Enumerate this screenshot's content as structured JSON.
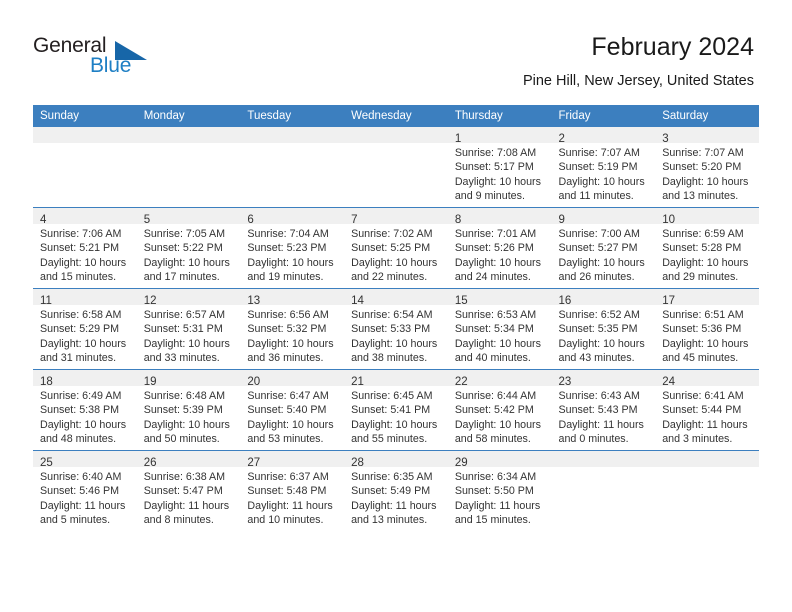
{
  "brand": {
    "name_part1": "General",
    "name_part2": "Blue",
    "logo_icon": "triangle-flag-icon"
  },
  "header": {
    "title": "February 2024",
    "location": "Pine Hill, New Jersey, United States"
  },
  "colors": {
    "header_blue": "#3c7fbf",
    "brand_blue": "#1e7fc4",
    "band_gray": "#f0f0f0",
    "text": "#333333"
  },
  "weekdays": [
    "Sunday",
    "Monday",
    "Tuesday",
    "Wednesday",
    "Thursday",
    "Friday",
    "Saturday"
  ],
  "weeks": [
    [
      {
        "day": "",
        "lines": []
      },
      {
        "day": "",
        "lines": []
      },
      {
        "day": "",
        "lines": []
      },
      {
        "day": "",
        "lines": []
      },
      {
        "day": "1",
        "lines": [
          "Sunrise: 7:08 AM",
          "Sunset: 5:17 PM",
          "Daylight: 10 hours",
          "and 9 minutes."
        ]
      },
      {
        "day": "2",
        "lines": [
          "Sunrise: 7:07 AM",
          "Sunset: 5:19 PM",
          "Daylight: 10 hours",
          "and 11 minutes."
        ]
      },
      {
        "day": "3",
        "lines": [
          "Sunrise: 7:07 AM",
          "Sunset: 5:20 PM",
          "Daylight: 10 hours",
          "and 13 minutes."
        ]
      }
    ],
    [
      {
        "day": "4",
        "lines": [
          "Sunrise: 7:06 AM",
          "Sunset: 5:21 PM",
          "Daylight: 10 hours",
          "and 15 minutes."
        ]
      },
      {
        "day": "5",
        "lines": [
          "Sunrise: 7:05 AM",
          "Sunset: 5:22 PM",
          "Daylight: 10 hours",
          "and 17 minutes."
        ]
      },
      {
        "day": "6",
        "lines": [
          "Sunrise: 7:04 AM",
          "Sunset: 5:23 PM",
          "Daylight: 10 hours",
          "and 19 minutes."
        ]
      },
      {
        "day": "7",
        "lines": [
          "Sunrise: 7:02 AM",
          "Sunset: 5:25 PM",
          "Daylight: 10 hours",
          "and 22 minutes."
        ]
      },
      {
        "day": "8",
        "lines": [
          "Sunrise: 7:01 AM",
          "Sunset: 5:26 PM",
          "Daylight: 10 hours",
          "and 24 minutes."
        ]
      },
      {
        "day": "9",
        "lines": [
          "Sunrise: 7:00 AM",
          "Sunset: 5:27 PM",
          "Daylight: 10 hours",
          "and 26 minutes."
        ]
      },
      {
        "day": "10",
        "lines": [
          "Sunrise: 6:59 AM",
          "Sunset: 5:28 PM",
          "Daylight: 10 hours",
          "and 29 minutes."
        ]
      }
    ],
    [
      {
        "day": "11",
        "lines": [
          "Sunrise: 6:58 AM",
          "Sunset: 5:29 PM",
          "Daylight: 10 hours",
          "and 31 minutes."
        ]
      },
      {
        "day": "12",
        "lines": [
          "Sunrise: 6:57 AM",
          "Sunset: 5:31 PM",
          "Daylight: 10 hours",
          "and 33 minutes."
        ]
      },
      {
        "day": "13",
        "lines": [
          "Sunrise: 6:56 AM",
          "Sunset: 5:32 PM",
          "Daylight: 10 hours",
          "and 36 minutes."
        ]
      },
      {
        "day": "14",
        "lines": [
          "Sunrise: 6:54 AM",
          "Sunset: 5:33 PM",
          "Daylight: 10 hours",
          "and 38 minutes."
        ]
      },
      {
        "day": "15",
        "lines": [
          "Sunrise: 6:53 AM",
          "Sunset: 5:34 PM",
          "Daylight: 10 hours",
          "and 40 minutes."
        ]
      },
      {
        "day": "16",
        "lines": [
          "Sunrise: 6:52 AM",
          "Sunset: 5:35 PM",
          "Daylight: 10 hours",
          "and 43 minutes."
        ]
      },
      {
        "day": "17",
        "lines": [
          "Sunrise: 6:51 AM",
          "Sunset: 5:36 PM",
          "Daylight: 10 hours",
          "and 45 minutes."
        ]
      }
    ],
    [
      {
        "day": "18",
        "lines": [
          "Sunrise: 6:49 AM",
          "Sunset: 5:38 PM",
          "Daylight: 10 hours",
          "and 48 minutes."
        ]
      },
      {
        "day": "19",
        "lines": [
          "Sunrise: 6:48 AM",
          "Sunset: 5:39 PM",
          "Daylight: 10 hours",
          "and 50 minutes."
        ]
      },
      {
        "day": "20",
        "lines": [
          "Sunrise: 6:47 AM",
          "Sunset: 5:40 PM",
          "Daylight: 10 hours",
          "and 53 minutes."
        ]
      },
      {
        "day": "21",
        "lines": [
          "Sunrise: 6:45 AM",
          "Sunset: 5:41 PM",
          "Daylight: 10 hours",
          "and 55 minutes."
        ]
      },
      {
        "day": "22",
        "lines": [
          "Sunrise: 6:44 AM",
          "Sunset: 5:42 PM",
          "Daylight: 10 hours",
          "and 58 minutes."
        ]
      },
      {
        "day": "23",
        "lines": [
          "Sunrise: 6:43 AM",
          "Sunset: 5:43 PM",
          "Daylight: 11 hours",
          "and 0 minutes."
        ]
      },
      {
        "day": "24",
        "lines": [
          "Sunrise: 6:41 AM",
          "Sunset: 5:44 PM",
          "Daylight: 11 hours",
          "and 3 minutes."
        ]
      }
    ],
    [
      {
        "day": "25",
        "lines": [
          "Sunrise: 6:40 AM",
          "Sunset: 5:46 PM",
          "Daylight: 11 hours",
          "and 5 minutes."
        ]
      },
      {
        "day": "26",
        "lines": [
          "Sunrise: 6:38 AM",
          "Sunset: 5:47 PM",
          "Daylight: 11 hours",
          "and 8 minutes."
        ]
      },
      {
        "day": "27",
        "lines": [
          "Sunrise: 6:37 AM",
          "Sunset: 5:48 PM",
          "Daylight: 11 hours",
          "and 10 minutes."
        ]
      },
      {
        "day": "28",
        "lines": [
          "Sunrise: 6:35 AM",
          "Sunset: 5:49 PM",
          "Daylight: 11 hours",
          "and 13 minutes."
        ]
      },
      {
        "day": "29",
        "lines": [
          "Sunrise: 6:34 AM",
          "Sunset: 5:50 PM",
          "Daylight: 11 hours",
          "and 15 minutes."
        ]
      },
      {
        "day": "",
        "lines": []
      },
      {
        "day": "",
        "lines": []
      }
    ]
  ]
}
